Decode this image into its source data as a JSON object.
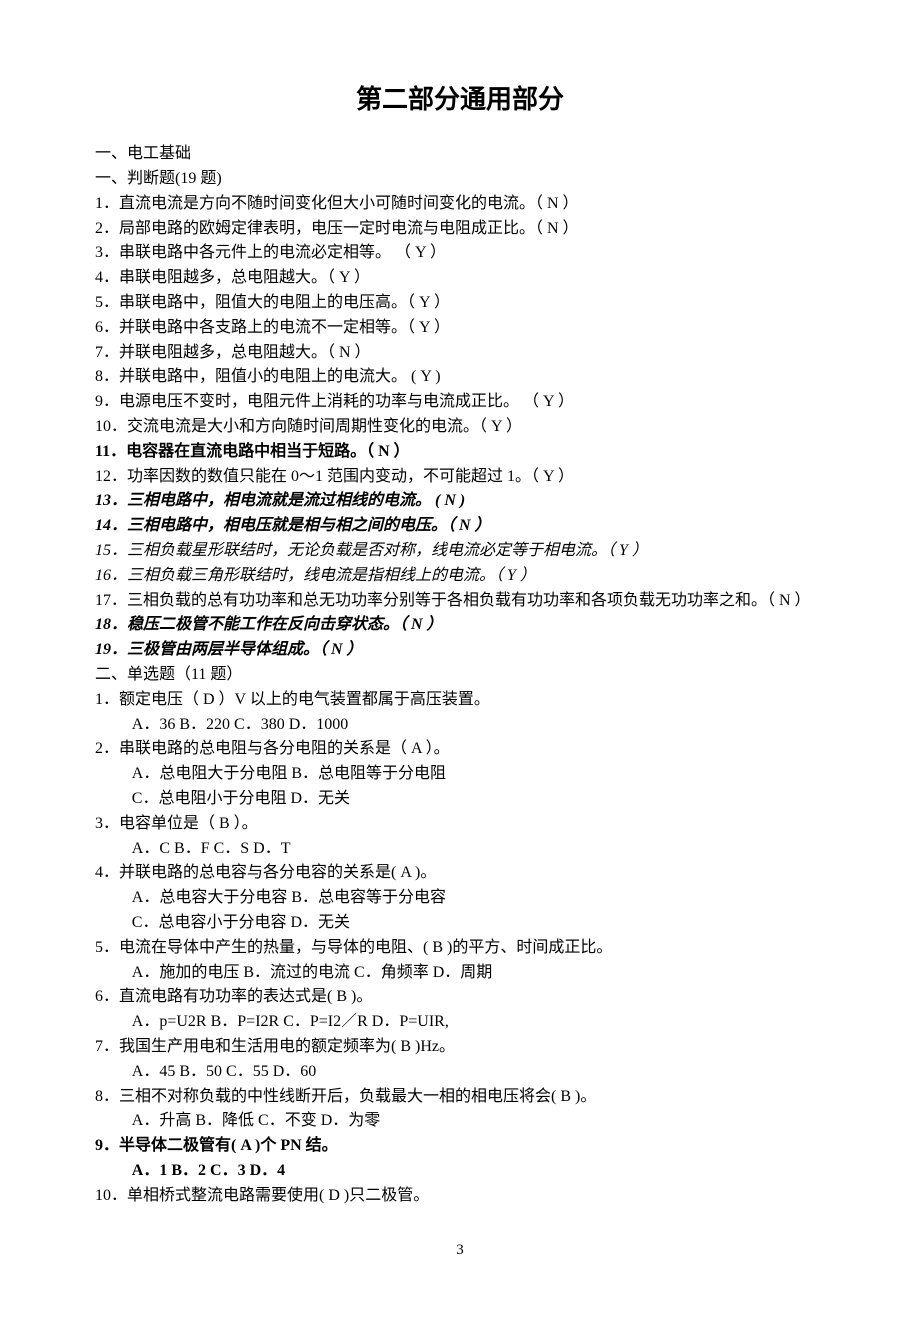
{
  "title": "第二部分通用部分",
  "sec1_header": "一、电工基础",
  "tf_header": "一、判断题(19 题)",
  "tf": [
    {
      "text": "1．直流电流是方向不随时间变化但大小可随时间变化的电流。（   N   ）",
      "cls": ""
    },
    {
      "text": "2．局部电路的欧姆定律表明，电压一定时电流与电阻成正比。（   N   ）",
      "cls": ""
    },
    {
      "text": "3．串联电路中各元件上的电流必定相等。   （  Y  ）",
      "cls": ""
    },
    {
      "text": "4．串联电阻越多，总电阻越大。（   Y   ）",
      "cls": ""
    },
    {
      "text": "5．串联电路中，阻值大的电阻上的电压高。（   Y   ）",
      "cls": ""
    },
    {
      "text": "6．并联电路中各支路上的电流不一定相等。（  Y   ）",
      "cls": ""
    },
    {
      "text": "7．并联电阻越多，总电阻越大。（   N   ）",
      "cls": ""
    },
    {
      "text": "8．并联电路中，阻值小的电阻上的电流大。  (   Y    )",
      "cls": ""
    },
    {
      "text": "9．电源电压不变时，电阻元件上消耗的功率与电流成正比。   （   Y   ）",
      "cls": ""
    },
    {
      "text": "10．交流电流是大小和方向随时间周期性变化的电流。（   Y   ）",
      "cls": ""
    },
    {
      "text": "11．电容器在直流电路中相当于短路。（   N   ）",
      "cls": "bold"
    },
    {
      "text": "12．功率因数的数值只能在 0～1 范围内变动，不可能超过 1。（   Y   ）",
      "cls": ""
    },
    {
      "text": "13．三相电路中，相电流就是流过相线的电流。  (   N   )",
      "cls": "bold-italic"
    },
    {
      "text": "14．三相电路中，相电压就是相与相之间的电压。（   N   ）",
      "cls": "bold-italic"
    },
    {
      "text": "15．三相负载星形联结时，无论负载是否对称，线电流必定等于相电流。（ Y  ）",
      "cls": "italic"
    },
    {
      "text": "16．三相负载三角形联结时，线电流是指相线上的电流。（   Y   ）",
      "cls": "italic"
    },
    {
      "text": "17．三相负载的总有功功率和总无功功率分别等于各相负载有功功率和各项负载无功功率之和。（   N   ）",
      "cls": ""
    },
    {
      "text": "18．稳压二极管不能工作在反向击穿状态。（ N   ）",
      "cls": "bold-italic"
    },
    {
      "text": "19．三极管由两层半导体组成。（ N  ）",
      "cls": "bold-italic"
    }
  ],
  "mc_header": "二、单选题（11 题）",
  "mc": [
    {
      "q": "1．额定电压（   D   ）V 以上的电气装置都属于高压装置。",
      "opts": " A．36     B．220     C．380     D．1000",
      "cls": ""
    },
    {
      "q": "2．串联电路的总电阻与各分电阻的关系是（ A  ）。",
      "opts": "A．总电阻大于分电阻   B．总电阻等于分电阻",
      "opts2": "C．总电阻小于分电阻   D．无关",
      "cls": ""
    },
    {
      "q": "3．电容单位是（   B   ）。",
      "opts": " A．C     B．F     C．S     D．T",
      "cls": ""
    },
    {
      "q": "4．并联电路的总电容与各分电容的关系是(    A     )。",
      "opts": "A．总电容大于分电容   B．总电容等于分电容",
      "opts2": "C．总电容小于分电容   D．无关",
      "cls": ""
    },
    {
      "q": "5．电流在导体中产生的热量，与导体的电阻、(     B     )的平方、时间成正比。",
      "opts": "A．施加的电压   B．流过的电流   C．角频率    D．周期",
      "cls": ""
    },
    {
      "q": "6．直流电路有功功率的表达式是(   B     )。",
      "opts": "A．p=U2R     B．P=I2R      C．P=I2／R       D．P=UIR,",
      "cls": ""
    },
    {
      "q": "7．我国生产用电和生活用电的额定频率为(    B     )Hz。",
      "opts": " A．45     B．50     C．55 D．60",
      "cls": ""
    },
    {
      "q": "8．三相不对称负载的中性线断开后，负载最大一相的相电压将会(    B     )。",
      "opts": "A．升高     B．降低     C．不变     D．为零",
      "cls": ""
    },
    {
      "q": "9．半导体二极管有(    A     )个 PN 结。",
      "opts": "A．1     B．2     C．3      D．4",
      "cls": "bold"
    },
    {
      "q": "10．单相桥式整流电路需要使用(    D     )只二极管。",
      "opts": "",
      "cls": ""
    }
  ],
  "page_number": "3"
}
